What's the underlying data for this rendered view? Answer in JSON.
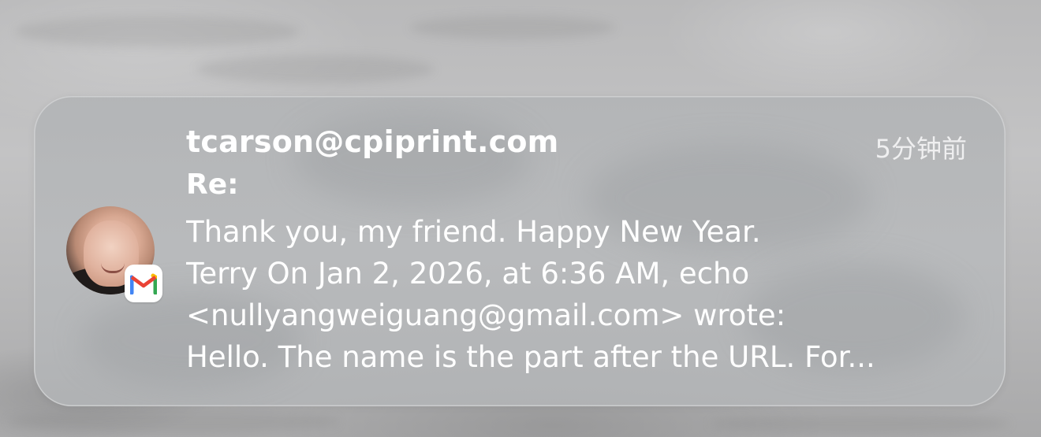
{
  "notification": {
    "sender": "tcarson@cpiprint.com",
    "time": "5分钟前",
    "subject": "Re:",
    "body_lines": [
      "Thank you, my friend. Happy New Year.",
      "Terry On Jan 2, 2026, at 6:36 AM, echo",
      "<nullyangweiguang@gmail.com> wrote:",
      "Hello. The name is the part after the URL. For..."
    ],
    "app_icon": "gmail-icon",
    "avatar_icon": "contact-avatar",
    "colors": {
      "gmail_red": "#EA4335",
      "gmail_blue": "#4285F4",
      "gmail_green": "#34A853",
      "gmail_yellow": "#FBBC04"
    }
  }
}
